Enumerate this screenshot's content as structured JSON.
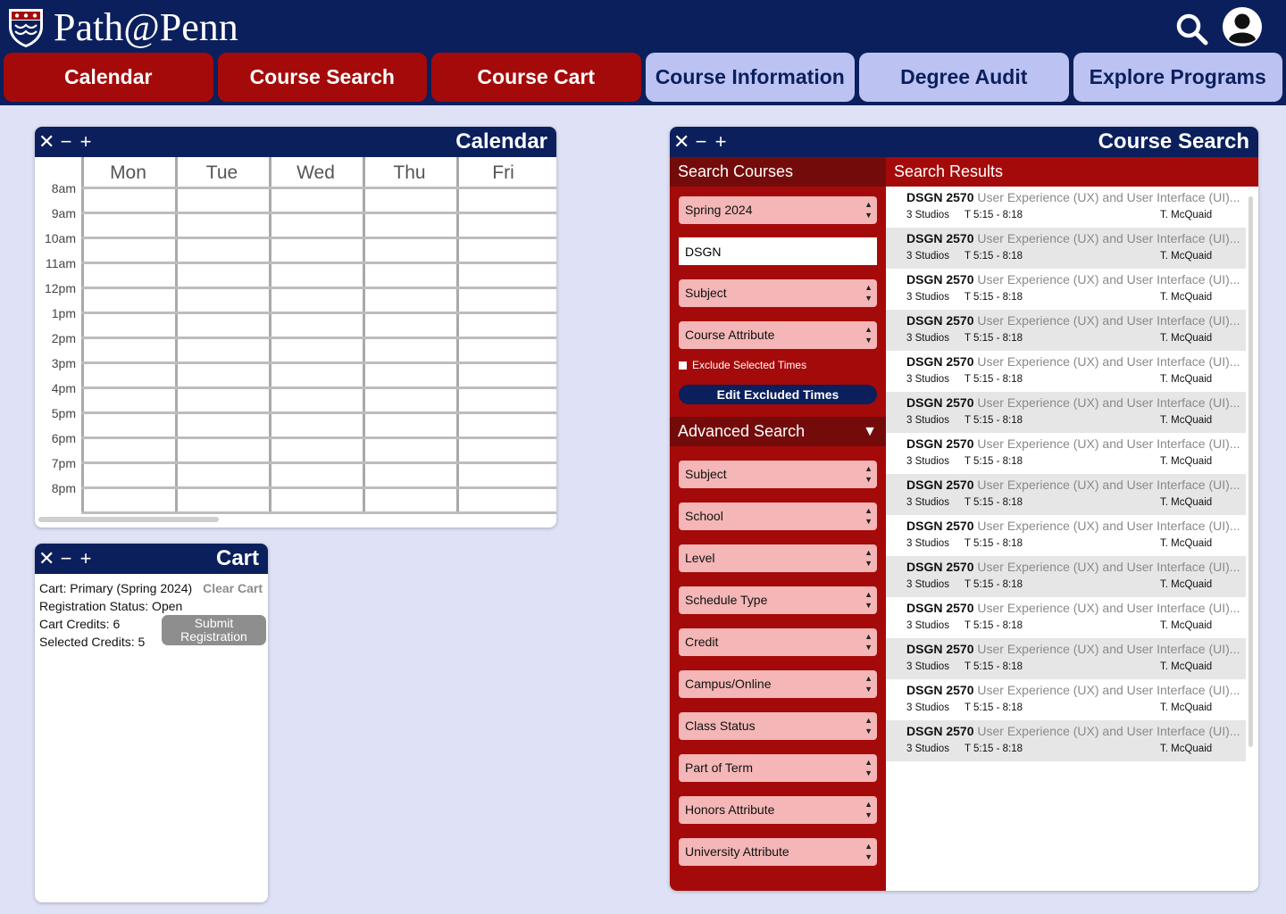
{
  "app": {
    "name": "Path@Penn",
    "colors": {
      "navy": "#0b1f5c",
      "penn_red": "#a50a0a",
      "dark_red": "#740b0b",
      "tab_light": "#bcc3f3",
      "field_pink": "#f4b6b6",
      "page_bg": "#dfe2f6"
    }
  },
  "nav": {
    "tabs": [
      {
        "label": "Calendar",
        "style": "red"
      },
      {
        "label": "Course Search",
        "style": "red"
      },
      {
        "label": "Course Cart",
        "style": "red"
      },
      {
        "label": "Course Information",
        "style": "light"
      },
      {
        "label": "Degree Audit",
        "style": "light"
      },
      {
        "label": "Explore Programs",
        "style": "light"
      }
    ]
  },
  "window_controls": {
    "close": "✕",
    "minimize": "−",
    "maximize": "+"
  },
  "calendar": {
    "title": "Calendar",
    "days": [
      "Mon",
      "Tue",
      "Wed",
      "Thu",
      "Fri"
    ],
    "times": [
      "8am",
      "9am",
      "10am",
      "11am",
      "12pm",
      "1pm",
      "2pm",
      "3pm",
      "4pm",
      "5pm",
      "6pm",
      "7pm",
      "8pm"
    ]
  },
  "cart": {
    "title": "Cart",
    "cart_name": "Cart: Primary (Spring 2024)",
    "clear_label": "Clear Cart",
    "registration_status": "Registration Status: Open",
    "cart_credits": "Cart Credits: 6",
    "selected_credits": "Selected Credits: 5",
    "submit_line1": "Submit",
    "submit_line2": "Registration"
  },
  "course_search": {
    "title": "Course Search",
    "search_header": "Search Courses",
    "results_header": "Search Results",
    "term": "Spring 2024",
    "query": "DSGN",
    "subject": "Subject",
    "course_attribute": "Course Attribute",
    "exclude_label": "Exclude Selected Times",
    "edit_times_label": "Edit Excluded Times",
    "advanced_header": "Advanced Search",
    "advanced_toggle": "▼",
    "advanced_fields": [
      "Subject",
      "School",
      "Level",
      "Schedule Type",
      "Credit",
      "Campus/Online",
      "Class Status",
      "Part of Term",
      "Honors Attribute",
      "University Attribute"
    ],
    "results": [
      {
        "code": "DSGN 2570",
        "name": "User Experience (UX) and User Interface (UI)...",
        "format": "3 Studios",
        "time": "T 5:15 - 8:18",
        "instructor": "T. McQuaid"
      },
      {
        "code": "DSGN 2570",
        "name": "User Experience (UX) and User Interface (UI)...",
        "format": "3 Studios",
        "time": "T 5:15 - 8:18",
        "instructor": "T. McQuaid"
      },
      {
        "code": "DSGN 2570",
        "name": "User Experience (UX) and User Interface (UI)...",
        "format": "3 Studios",
        "time": "T 5:15 - 8:18",
        "instructor": "T. McQuaid"
      },
      {
        "code": "DSGN 2570",
        "name": "User Experience (UX) and User Interface (UI)...",
        "format": "3 Studios",
        "time": "T 5:15 - 8:18",
        "instructor": "T. McQuaid"
      },
      {
        "code": "DSGN 2570",
        "name": "User Experience (UX) and User Interface (UI)...",
        "format": "3 Studios",
        "time": "T 5:15 - 8:18",
        "instructor": "T. McQuaid"
      },
      {
        "code": "DSGN 2570",
        "name": "User Experience (UX) and User Interface (UI)...",
        "format": "3 Studios",
        "time": "T 5:15 - 8:18",
        "instructor": "T. McQuaid"
      },
      {
        "code": "DSGN 2570",
        "name": "User Experience (UX) and User Interface (UI)...",
        "format": "3 Studios",
        "time": "T 5:15 - 8:18",
        "instructor": "T. McQuaid"
      },
      {
        "code": "DSGN 2570",
        "name": "User Experience (UX) and User Interface (UI)...",
        "format": "3 Studios",
        "time": "T 5:15 - 8:18",
        "instructor": "T. McQuaid"
      },
      {
        "code": "DSGN 2570",
        "name": "User Experience (UX) and User Interface (UI)...",
        "format": "3 Studios",
        "time": "T 5:15 - 8:18",
        "instructor": "T. McQuaid"
      },
      {
        "code": "DSGN 2570",
        "name": "User Experience (UX) and User Interface (UI)...",
        "format": "3 Studios",
        "time": "T 5:15 - 8:18",
        "instructor": "T. McQuaid"
      },
      {
        "code": "DSGN 2570",
        "name": "User Experience (UX) and User Interface (UI)...",
        "format": "3 Studios",
        "time": "T 5:15 - 8:18",
        "instructor": "T. McQuaid"
      },
      {
        "code": "DSGN 2570",
        "name": "User Experience (UX) and User Interface (UI)...",
        "format": "3 Studios",
        "time": "T 5:15 - 8:18",
        "instructor": "T. McQuaid"
      },
      {
        "code": "DSGN 2570",
        "name": "User Experience (UX) and User Interface (UI)...",
        "format": "3 Studios",
        "time": "T 5:15 - 8:18",
        "instructor": "T. McQuaid"
      },
      {
        "code": "DSGN 2570",
        "name": "User Experience (UX) and User Interface (UI)...",
        "format": "3 Studios",
        "time": "T 5:15 - 8:18",
        "instructor": "T. McQuaid"
      }
    ]
  }
}
